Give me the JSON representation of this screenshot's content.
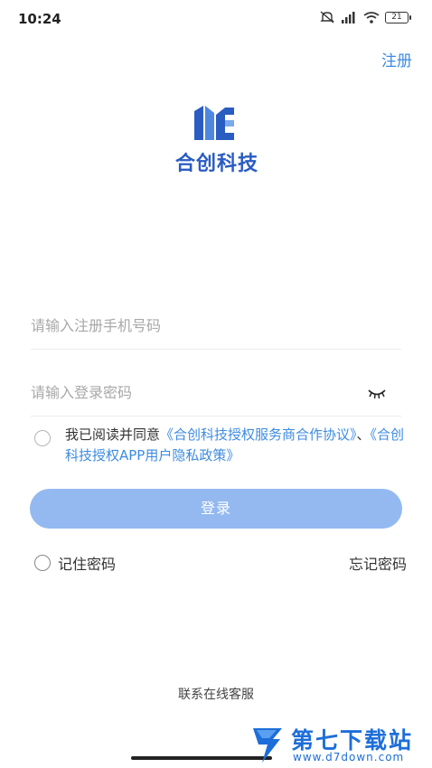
{
  "status_bar": {
    "time": "10:24",
    "battery": "21",
    "icons": [
      "mute-icon",
      "hd-signal-icon",
      "wifi-icon",
      "battery-icon"
    ]
  },
  "header": {
    "register_label": "注册"
  },
  "logo": {
    "company_name": "合创科技"
  },
  "form": {
    "phone_placeholder": "请输入注册手机号码",
    "phone_value": "",
    "password_placeholder": "请输入登录密码",
    "password_value": ""
  },
  "agreement": {
    "prefix": "我已阅读并同意",
    "service_link": "《合创科技授权服务商合作协议》",
    "separator": "、",
    "privacy_link": "《合创科技授权APP用户隐私政策》"
  },
  "login_label": "登录",
  "remember_label": "记住密码",
  "forgot_label": "忘记密码",
  "support_label": "联系在线客服",
  "watermark": {
    "title": "第七下载站",
    "url": "www.d7down.com"
  },
  "colors": {
    "accent": "#3d8be0",
    "button": "#93b9f0",
    "logo": "#2a5cc2",
    "watermark": "#1d6ed9"
  }
}
